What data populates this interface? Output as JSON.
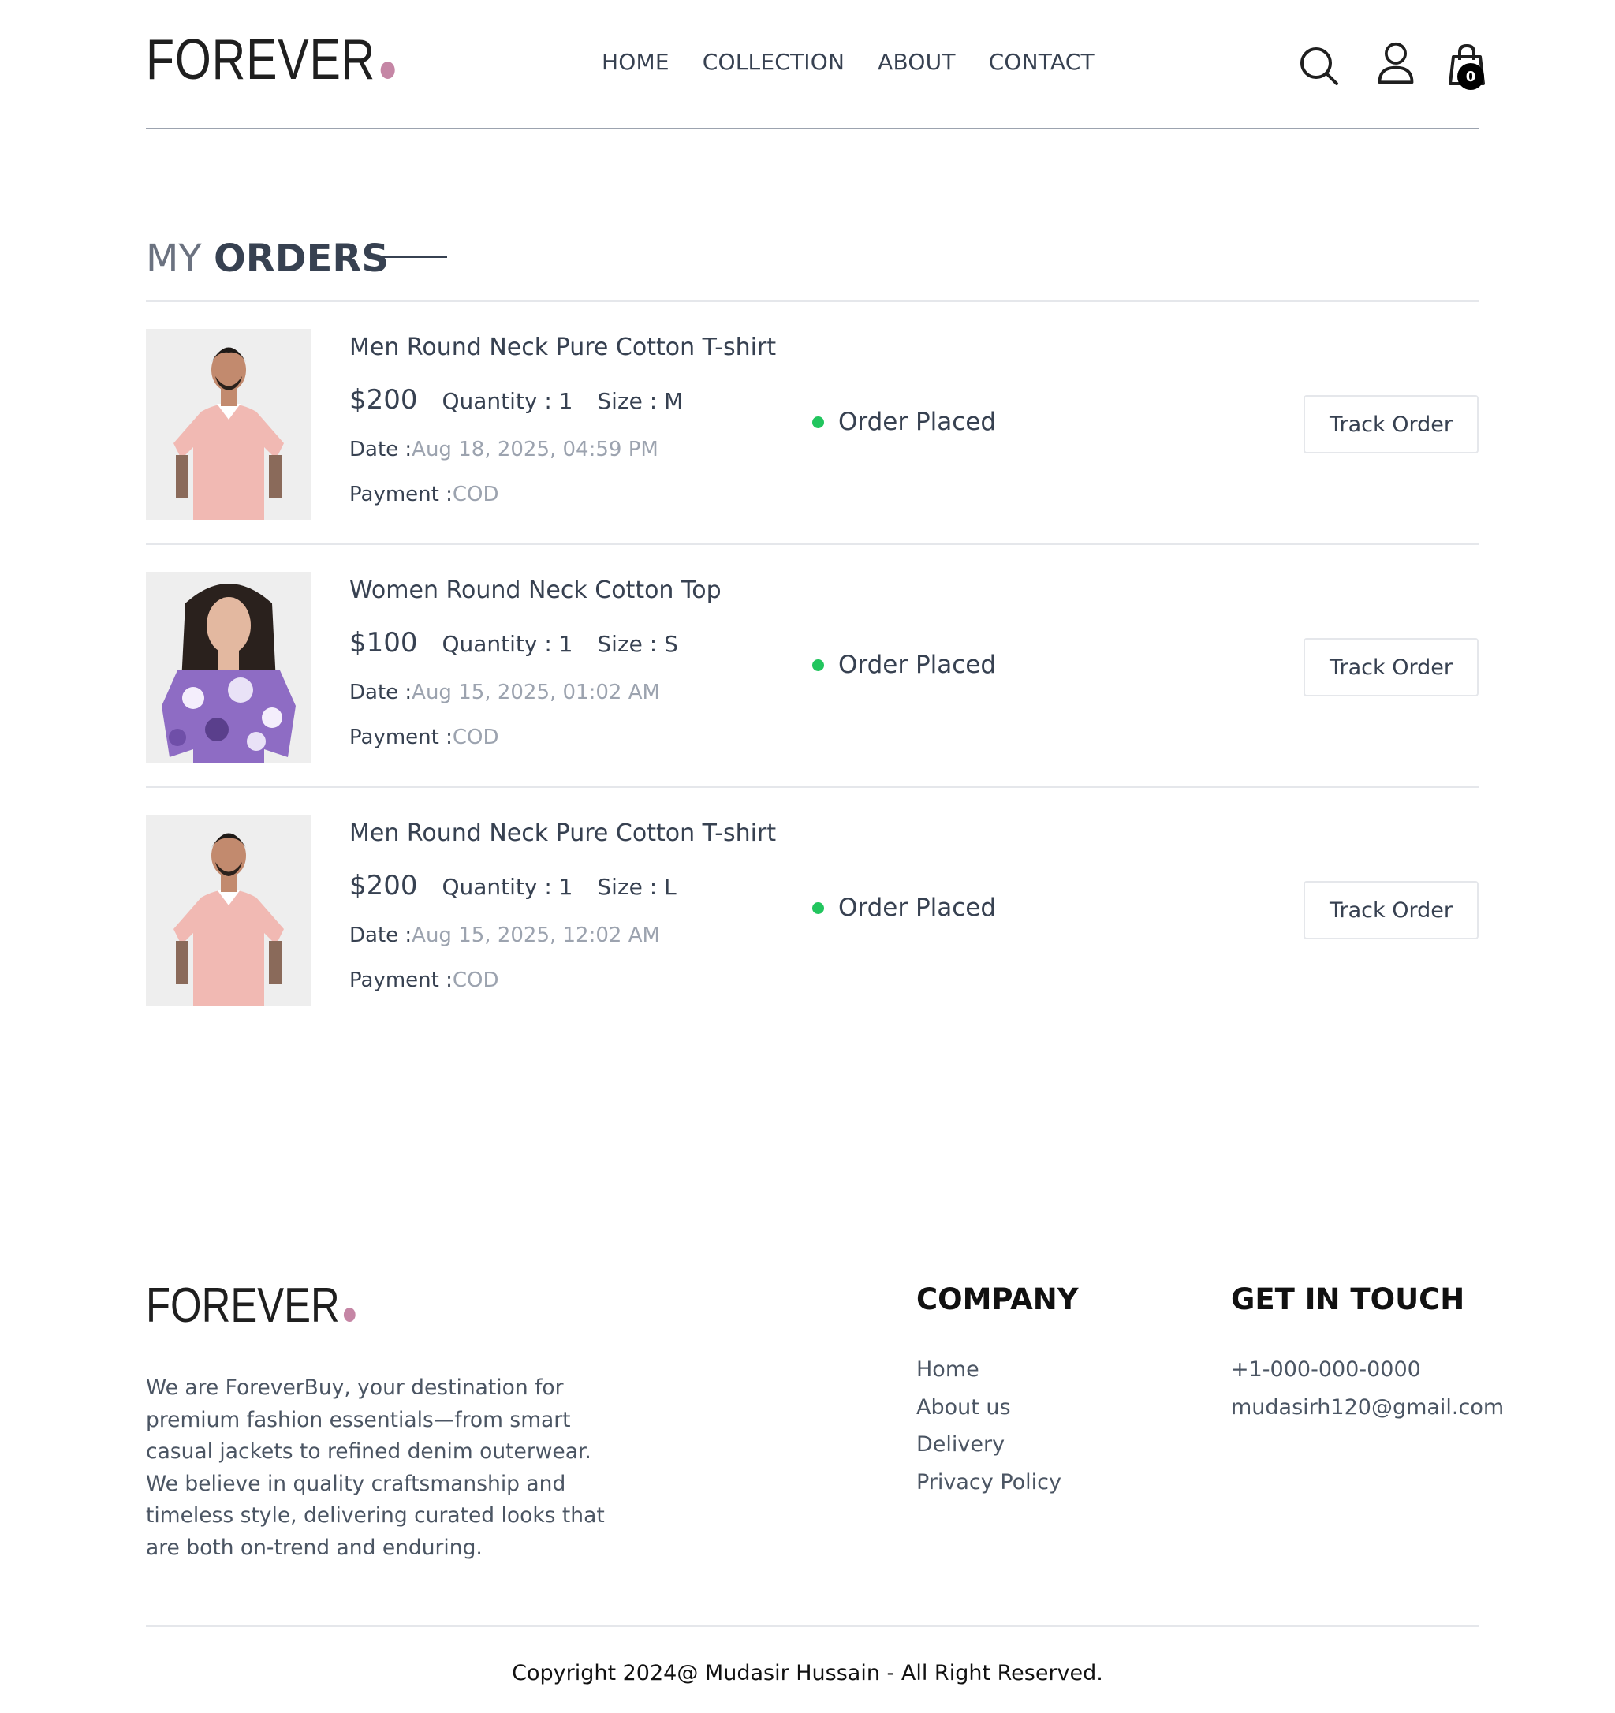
{
  "brand": {
    "name": "FOREVER",
    "dot_color": "#c586a5"
  },
  "nav": {
    "items": [
      "HOME",
      "COLLECTION",
      "ABOUT",
      "CONTACT"
    ]
  },
  "header_icons": {
    "search": "search-icon",
    "profile": "user-icon",
    "cart": "shopping-bag-icon",
    "cart_count": "0"
  },
  "page": {
    "title_part1": "MY",
    "title_part2": "ORDERS"
  },
  "orders": [
    {
      "name": "Men Round Neck Pure Cotton T-shirt",
      "price": "$200",
      "quantity": "Quantity : 1",
      "size": "Size : M",
      "date_label": "Date :",
      "date": "Aug 18, 2025, 04:59 PM",
      "payment_label": "Payment :",
      "payment": "COD",
      "status": "Order Placed",
      "action": "Track Order"
    },
    {
      "name": "Women Round Neck Cotton Top",
      "price": "$100",
      "quantity": "Quantity : 1",
      "size": "Size : S",
      "date_label": "Date :",
      "date": "Aug 15, 2025, 01:02 AM",
      "payment_label": "Payment :",
      "payment": "COD",
      "status": "Order Placed",
      "action": "Track Order"
    },
    {
      "name": "Men Round Neck Pure Cotton T-shirt",
      "price": "$200",
      "quantity": "Quantity : 1",
      "size": "Size : L",
      "date_label": "Date :",
      "date": "Aug 15, 2025, 12:02 AM",
      "payment_label": "Payment :",
      "payment": "COD",
      "status": "Order Placed",
      "action": "Track Order"
    }
  ],
  "colors": {
    "status_dot": "#22c55e",
    "muted": "#9ca3af",
    "text": "#374151"
  },
  "footer": {
    "description": "We are ForeverBuy, your destination for premium fashion essentials—from smart casual jackets to refined denim outerwear. We believe in quality craftsmanship and timeless style, delivering curated looks that are both on-trend and enduring.",
    "company_heading": "COMPANY",
    "company_links": [
      "Home",
      "About us",
      "Delivery",
      "Privacy Policy"
    ],
    "contact_heading": "GET IN TOUCH",
    "phone": "+1-000-000-0000",
    "email": "mudasirh120@gmail.com",
    "copyright": "Copyright 2024@ Mudasir Hussain - All Right Reserved."
  }
}
